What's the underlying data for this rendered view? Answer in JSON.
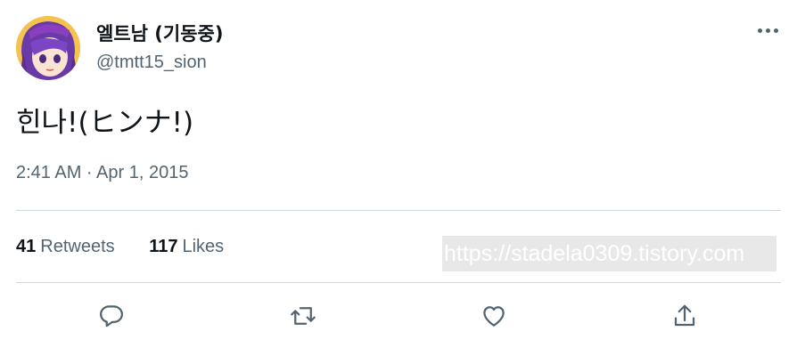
{
  "author": {
    "display_name": "엘트남 (기동중)",
    "handle": "@tmtt15_sion"
  },
  "tweet": {
    "text": "힌나!(ヒンナ!)",
    "timestamp": "2:41 AM · Apr 1, 2015"
  },
  "stats": {
    "retweets_count": "41",
    "retweets_label": "Retweets",
    "likes_count": "117",
    "likes_label": "Likes"
  },
  "watermark": "https://stadela0309.tistory.com",
  "icons": {
    "more": "more-horizontal-icon",
    "reply": "reply-icon",
    "retweet": "retweet-icon",
    "like": "heart-icon",
    "share": "share-icon"
  },
  "colors": {
    "text_primary": "#0f1419",
    "text_secondary": "#536471",
    "divider": "#cfd9de"
  }
}
